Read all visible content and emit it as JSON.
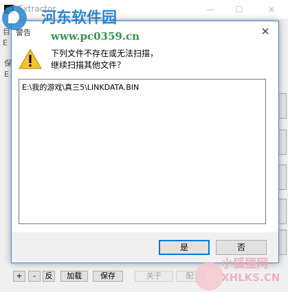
{
  "main_window": {
    "title": "Extractor",
    "fragments": {
      "label_a": "目",
      "label_b": "保",
      "field_a": "E",
      "field_b": "E"
    },
    "bottom_buttons": [
      {
        "label": "+",
        "enabled": true
      },
      {
        "label": "-",
        "enabled": true
      },
      {
        "label": "反",
        "enabled": true
      },
      {
        "label": "加载",
        "enabled": true
      },
      {
        "label": "保存",
        "enabled": true
      },
      {
        "label": "关于",
        "enabled": false
      },
      {
        "label": "配",
        "enabled": false
      }
    ]
  },
  "dialog": {
    "title": "警告",
    "icon": "warning-icon",
    "message_line1": "下列文件不存在或无法扫描，",
    "message_line2": "继续扫描其他文件？",
    "files": [
      "E:\\我的游戏\\真三5\\LINKDATA.BIN"
    ],
    "yes_label": "是",
    "no_label": "否"
  },
  "watermarks": {
    "top_cn": "河东软件园",
    "top_url": "www.pc0359.cn",
    "bottom_cn": "小狐狸网",
    "bottom_en": "XHLKS.CN"
  },
  "colors": {
    "accent": "#0078d7",
    "warning": "#f2c12e",
    "dialog_border": "#3a8ae0"
  }
}
